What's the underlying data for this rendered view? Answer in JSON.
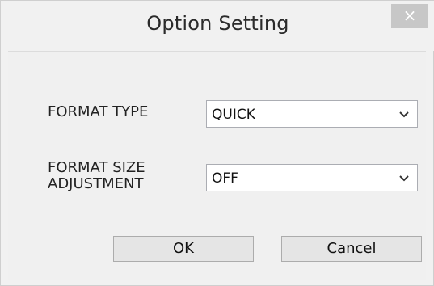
{
  "window": {
    "title": "Option Setting",
    "close_glyph": "×"
  },
  "form": {
    "format_type": {
      "label": "FORMAT TYPE",
      "value": "QUICK"
    },
    "format_size_adjustment": {
      "label_line1": "FORMAT SIZE",
      "label_line2": "ADJUSTMENT",
      "value": "OFF"
    }
  },
  "buttons": {
    "ok_label": "OK",
    "cancel_label": "Cancel"
  },
  "icons": {
    "dropdown": "chevron-down-icon",
    "close": "close-icon"
  }
}
